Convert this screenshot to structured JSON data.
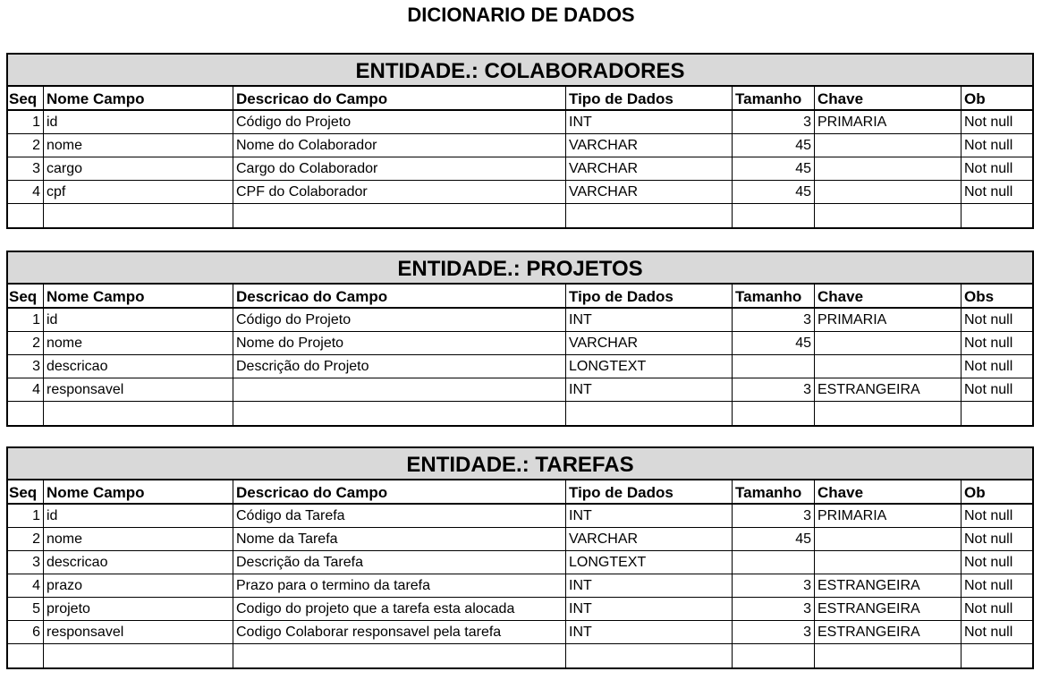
{
  "title": "DICIONARIO DE DADOS",
  "entities": [
    {
      "header": "ENTIDADE.: COLABORADORES",
      "columns": [
        "Seq",
        "Nome Campo",
        "Descricao do Campo",
        "Tipo de Dados",
        "Tamanho",
        "Chave",
        "Ob"
      ],
      "rows": [
        [
          "1",
          "id",
          "Código do Projeto",
          "INT",
          "3",
          "PRIMARIA",
          "Not null"
        ],
        [
          "2",
          "nome",
          "Nome do Colaborador",
          "VARCHAR",
          "45",
          "",
          "Not null"
        ],
        [
          "3",
          "cargo",
          "Cargo do Colaborador",
          "VARCHAR",
          "45",
          "",
          "Not null"
        ],
        [
          "4",
          "cpf",
          "CPF do Colaborador",
          "VARCHAR",
          "45",
          "",
          "Not null"
        ],
        [
          "",
          "",
          "",
          "",
          "",
          "",
          ""
        ]
      ]
    },
    {
      "header": "ENTIDADE.: PROJETOS",
      "columns": [
        "Seq",
        "Nome Campo",
        "Descricao do Campo",
        "Tipo de Dados",
        "Tamanho",
        "Chave",
        "Obs"
      ],
      "rows": [
        [
          "1",
          "id",
          "Código do Projeto",
          "INT",
          "3",
          "PRIMARIA",
          "Not null"
        ],
        [
          "2",
          "nome",
          "Nome do Projeto",
          "VARCHAR",
          "45",
          "",
          "Not null"
        ],
        [
          "3",
          "descricao",
          "Descrição do Projeto",
          "LONGTEXT",
          "",
          "",
          "Not null"
        ],
        [
          "4",
          "responsavel",
          "",
          "INT",
          "3",
          "ESTRANGEIRA",
          "Not null"
        ],
        [
          "",
          "",
          "",
          "",
          "",
          "",
          ""
        ]
      ]
    },
    {
      "header": "ENTIDADE.: TAREFAS",
      "columns": [
        "Seq",
        "Nome Campo",
        "Descricao do Campo",
        "Tipo de Dados",
        "Tamanho",
        "Chave",
        "Ob"
      ],
      "rows": [
        [
          "1",
          "id",
          "Código da Tarefa",
          "INT",
          "3",
          "PRIMARIA",
          "Not null"
        ],
        [
          "2",
          "nome",
          "Nome da Tarefa",
          "VARCHAR",
          "45",
          "",
          "Not null"
        ],
        [
          "3",
          "descricao",
          "Descrição da Tarefa",
          "LONGTEXT",
          "",
          "",
          "Not null"
        ],
        [
          "4",
          "prazo",
          "Prazo para o termino da tarefa",
          "INT",
          "3",
          "ESTRANGEIRA",
          "Not null"
        ],
        [
          "5",
          "projeto",
          "Codigo do projeto que a tarefa esta alocada",
          "INT",
          "3",
          "ESTRANGEIRA",
          "Not null"
        ],
        [
          "6",
          "responsavel",
          "Codigo Colaborar responsavel pela tarefa",
          "INT",
          "3",
          "ESTRANGEIRA",
          "Not null"
        ],
        [
          "",
          "",
          "",
          "",
          "",
          "",
          ""
        ]
      ]
    }
  ]
}
